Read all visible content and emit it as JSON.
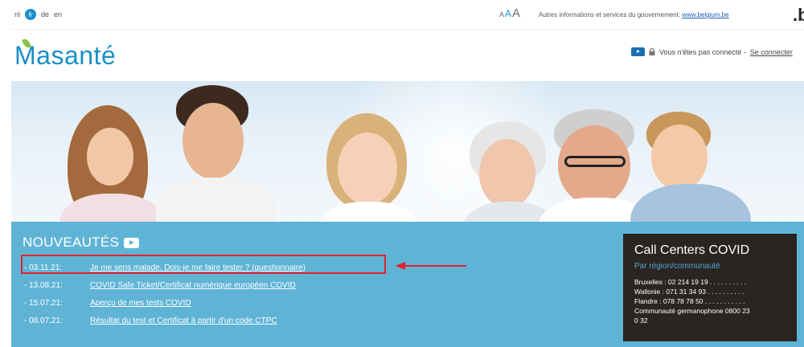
{
  "topbar": {
    "languages": [
      {
        "code": "nl",
        "active": false
      },
      {
        "code": "fr",
        "active": true
      },
      {
        "code": "de",
        "active": false
      },
      {
        "code": "en",
        "active": false
      }
    ],
    "text_size_labels": [
      "A",
      "A",
      "A"
    ],
    "gov_text": "Autres informations et services du gouvernement:",
    "gov_link": "www.belgium.be",
    "be_logo": ".be"
  },
  "header": {
    "logo_ma": "Ma",
    "logo_sante": "santé",
    "login_status": "Vous n'êtes pas connecté -",
    "login_link": "Se connecter"
  },
  "news": {
    "title": "NOUVEAUTÉS",
    "items": [
      {
        "date": "- 03.11.21:",
        "label": "Je me sens malade. Dois-je me faire tester ? (questionnaire)"
      },
      {
        "date": "- 13.08.21:",
        "label": "COVID Safe Ticket/Certificat numérique européen COVID"
      },
      {
        "date": "- 15.07.21:",
        "label": "Aperçu de mes tests COVID"
      },
      {
        "date": "- 08.07.21:",
        "label": "Résultat du test et Certificat à partir d'un code CTPC"
      }
    ]
  },
  "call_centers": {
    "title": "Call Centers COVID",
    "subtitle": "Par région/communauté",
    "lines": [
      "Bruxelles : 02 214 19 19 . . . . . . . . . .",
      "Wallonie : 071 31 34 93 . . . . . . . . . .",
      "Flandre : 078 78 78 50 . . . . . . . . . . .",
      "Communauté germanophone 0800 23",
      "0 32"
    ]
  },
  "colors": {
    "brand_blue": "#1a8fc9",
    "news_band": "#5fb4d6",
    "call_box": "#2b2522",
    "highlight_red": "#e0222c"
  },
  "icons": {
    "youtube": "youtube-icon",
    "lock": "lock-icon",
    "arrow": "red-arrow-annotation"
  }
}
